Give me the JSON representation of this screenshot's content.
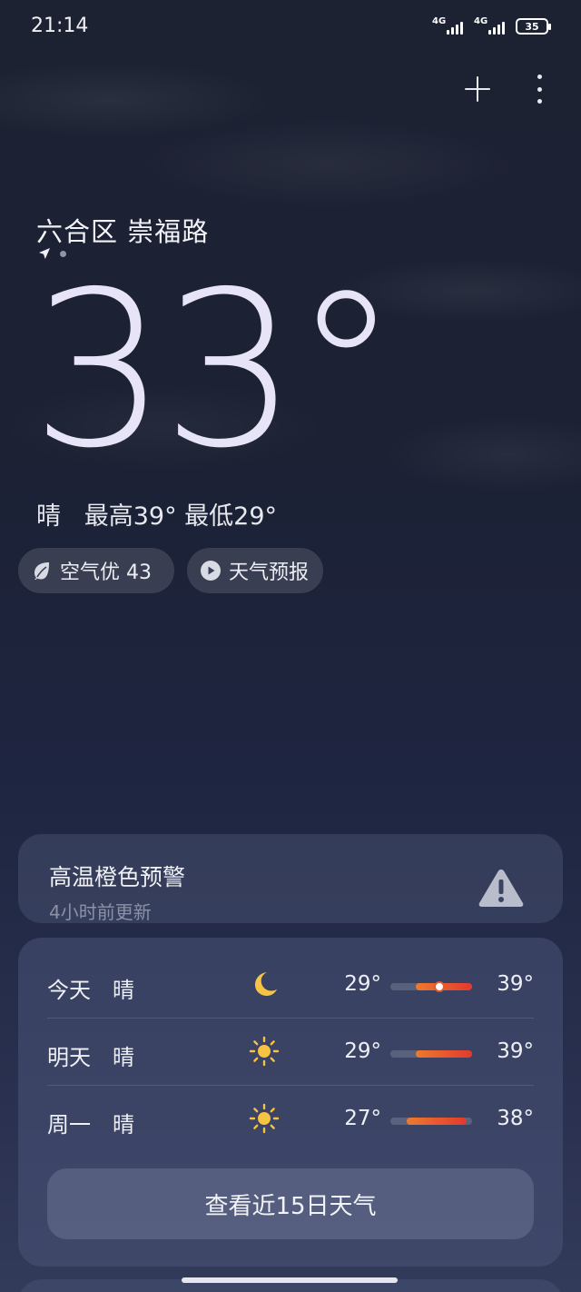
{
  "status_bar": {
    "time": "21:14",
    "signal1_label": "4G",
    "signal2_label": "4G",
    "battery_level": "35"
  },
  "header": {
    "add_icon": "plus-icon",
    "more_icon": "more-vertical-icon"
  },
  "location": {
    "name": "六合区 崇福路",
    "page_count": 2,
    "current_page": 0
  },
  "current": {
    "temperature": "33°",
    "summary": "晴   最高39° 最低29°"
  },
  "chips": {
    "air_quality": "空气优 43",
    "forecast": "天气预报"
  },
  "alert": {
    "title": "高温橙色预警",
    "updated": "4小时前更新",
    "icon": "warning-icon",
    "icon_color": "#b8bccb"
  },
  "forecast": {
    "rows": [
      {
        "day": "今天",
        "condition": "晴",
        "icon": "moon-icon",
        "low": "29°",
        "high": "39°",
        "current": 33
      },
      {
        "day": "明天",
        "condition": "晴",
        "icon": "sun-icon",
        "low": "29°",
        "high": "39°"
      },
      {
        "day": "周一",
        "condition": "晴",
        "icon": "sun-icon",
        "low": "27°",
        "high": "38°"
      }
    ],
    "button_label": "查看近15日天气"
  },
  "colors": {
    "accent_sun": "#f6c342",
    "bar_start": "#ee7a2e",
    "bar_end": "#e23a2d"
  }
}
